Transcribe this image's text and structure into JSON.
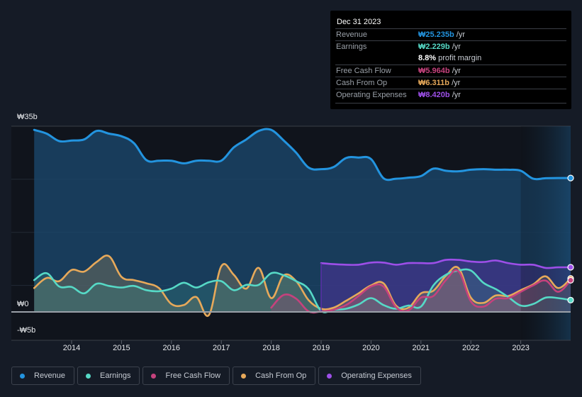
{
  "tooltip": {
    "date": "Dec 31 2023",
    "rows": [
      {
        "label": "Revenue",
        "value": "₩25.235b",
        "unit": " /yr",
        "color": "#2394df"
      },
      {
        "label": "Earnings",
        "value": "₩2.229b",
        "unit": " /yr",
        "color": "#56d9c6"
      },
      {
        "label": "",
        "value": "8.8%",
        "unit": " profit margin",
        "color": "#ffffff"
      },
      {
        "label": "Free Cash Flow",
        "value": "₩5.964b",
        "unit": " /yr",
        "color": "#c5427d"
      },
      {
        "label": "Cash From Op",
        "value": "₩6.311b",
        "unit": " /yr",
        "color": "#e7a95a"
      },
      {
        "label": "Operating Expenses",
        "value": "₩8.420b",
        "unit": " /yr",
        "color": "#9d4fe8"
      }
    ]
  },
  "legend": [
    {
      "label": "Revenue",
      "color": "#2394df"
    },
    {
      "label": "Earnings",
      "color": "#56d9c6"
    },
    {
      "label": "Free Cash Flow",
      "color": "#c5427d"
    },
    {
      "label": "Cash From Op",
      "color": "#e7a95a"
    },
    {
      "label": "Operating Expenses",
      "color": "#9d4fe8"
    }
  ],
  "chart_data": {
    "type": "area",
    "title": "",
    "xlabel": "",
    "ylabel": "",
    "y_tick_labels": [
      "₩35b",
      "₩0",
      "-₩5b"
    ],
    "y_ticks": [
      35,
      0,
      -5
    ],
    "ylim": [
      -5,
      35
    ],
    "xlim": [
      2013.25,
      2024.0
    ],
    "x_tick_labels": [
      "2014",
      "2015",
      "2016",
      "2017",
      "2018",
      "2019",
      "2020",
      "2021",
      "2022",
      "2023"
    ],
    "x_ticks": [
      2014,
      2015,
      2016,
      2017,
      2018,
      2019,
      2020,
      2021,
      2022,
      2023
    ],
    "grid": true,
    "forecast_shade_from": 2023.0,
    "series": [
      {
        "name": "Revenue",
        "color": "#2394df",
        "x": [
          2013.25,
          2013.5,
          2013.75,
          2014.0,
          2014.25,
          2014.5,
          2014.75,
          2015.0,
          2015.25,
          2015.5,
          2015.75,
          2016.0,
          2016.25,
          2016.5,
          2016.75,
          2017.0,
          2017.25,
          2017.5,
          2017.75,
          2018.0,
          2018.25,
          2018.5,
          2018.75,
          2019.0,
          2019.25,
          2019.5,
          2019.75,
          2020.0,
          2020.25,
          2020.5,
          2020.75,
          2021.0,
          2021.25,
          2021.5,
          2021.75,
          2022.0,
          2022.25,
          2022.5,
          2022.75,
          2023.0,
          2023.25,
          2023.5,
          2023.75,
          2024.0
        ],
        "values": [
          34.3,
          33.6,
          32.2,
          32.3,
          32.5,
          34.1,
          33.6,
          33.1,
          31.8,
          28.6,
          28.5,
          28.5,
          28.0,
          28.5,
          28.5,
          28.5,
          31.0,
          32.5,
          34.1,
          34.3,
          32.3,
          30.0,
          27.2,
          26.9,
          27.3,
          29.0,
          29.1,
          28.8,
          25.2,
          25.1,
          25.3,
          25.6,
          27.0,
          26.6,
          26.5,
          26.8,
          26.9,
          26.8,
          26.8,
          26.6,
          25.1,
          25.2,
          25.235,
          25.235
        ]
      },
      {
        "name": "Earnings",
        "color": "#56d9c6",
        "x": [
          2013.25,
          2013.5,
          2013.75,
          2014.0,
          2014.25,
          2014.5,
          2014.75,
          2015.0,
          2015.25,
          2015.5,
          2015.75,
          2016.0,
          2016.25,
          2016.5,
          2016.75,
          2017.0,
          2017.25,
          2017.5,
          2017.75,
          2018.0,
          2018.25,
          2018.5,
          2018.75,
          2019.0,
          2019.25,
          2019.5,
          2019.75,
          2020.0,
          2020.25,
          2020.5,
          2020.75,
          2021.0,
          2021.25,
          2021.5,
          2021.75,
          2022.0,
          2022.25,
          2022.5,
          2022.75,
          2023.0,
          2023.25,
          2023.5,
          2023.75,
          2024.0
        ],
        "values": [
          6.0,
          7.3,
          4.8,
          4.7,
          3.5,
          5.3,
          4.9,
          4.6,
          4.9,
          4.1,
          3.9,
          4.4,
          5.5,
          4.6,
          5.6,
          5.8,
          4.1,
          5.1,
          5.1,
          7.3,
          6.9,
          5.8,
          4.3,
          0.2,
          0.4,
          0.6,
          1.4,
          2.6,
          1.3,
          0.6,
          1.2,
          1.0,
          5.0,
          7.0,
          7.8,
          7.8,
          5.5,
          4.3,
          2.8,
          1.2,
          1.5,
          2.7,
          2.6,
          2.229
        ]
      },
      {
        "name": "Free Cash Flow",
        "color": "#c5427d",
        "x": [
          2018.0,
          2018.25,
          2018.5,
          2018.75,
          2019.0,
          2019.25,
          2019.5,
          2019.75,
          2020.0,
          2020.25,
          2020.5,
          2020.75,
          2021.0,
          2021.25,
          2021.5,
          2021.75,
          2022.0,
          2022.25,
          2022.5,
          2022.75,
          2023.0,
          2023.25,
          2023.5,
          2023.75,
          2024.0
        ],
        "values": [
          0.8,
          3.2,
          2.5,
          0.1,
          0.1,
          0.4,
          1.3,
          3.0,
          4.8,
          4.8,
          0.9,
          0.3,
          2.7,
          3.0,
          6.0,
          7.7,
          2.0,
          1.0,
          2.5,
          2.6,
          3.8,
          5.0,
          5.9,
          3.8,
          5.964
        ]
      },
      {
        "name": "Cash From Op",
        "color": "#e7a95a",
        "x": [
          2013.25,
          2013.5,
          2013.75,
          2014.0,
          2014.25,
          2014.5,
          2014.75,
          2015.0,
          2015.25,
          2015.5,
          2015.75,
          2016.0,
          2016.25,
          2016.5,
          2016.75,
          2017.0,
          2017.25,
          2017.5,
          2017.75,
          2018.0,
          2018.25,
          2018.5,
          2018.75,
          2019.0,
          2019.25,
          2019.5,
          2019.75,
          2020.0,
          2020.25,
          2020.5,
          2020.75,
          2021.0,
          2021.25,
          2021.5,
          2021.75,
          2022.0,
          2022.25,
          2022.5,
          2022.75,
          2023.0,
          2023.25,
          2023.5,
          2023.75,
          2024.0
        ],
        "values": [
          4.5,
          6.4,
          5.8,
          7.9,
          7.6,
          9.4,
          10.5,
          6.6,
          6.0,
          5.4,
          4.5,
          1.5,
          1.3,
          2.8,
          -0.6,
          8.6,
          7.0,
          4.4,
          8.3,
          2.6,
          6.9,
          5.8,
          2.2,
          0.6,
          0.8,
          2.1,
          3.5,
          5.0,
          5.4,
          1.2,
          0.8,
          3.5,
          4.0,
          6.8,
          8.3,
          2.7,
          1.7,
          3.1,
          3.0,
          4.1,
          5.2,
          6.7,
          4.5,
          6.311
        ]
      },
      {
        "name": "Operating Expenses",
        "color": "#9d4fe8",
        "x": [
          2019.0,
          2019.25,
          2019.5,
          2019.75,
          2020.0,
          2020.25,
          2020.5,
          2020.75,
          2021.0,
          2021.25,
          2021.5,
          2021.75,
          2022.0,
          2022.25,
          2022.5,
          2022.75,
          2023.0,
          2023.25,
          2023.5,
          2023.75,
          2024.0
        ],
        "values": [
          9.2,
          9.0,
          8.9,
          8.9,
          9.3,
          9.3,
          8.9,
          9.2,
          9.2,
          9.2,
          9.8,
          9.8,
          9.5,
          9.4,
          9.7,
          9.2,
          8.9,
          8.9,
          8.3,
          8.4,
          8.42
        ]
      }
    ]
  }
}
